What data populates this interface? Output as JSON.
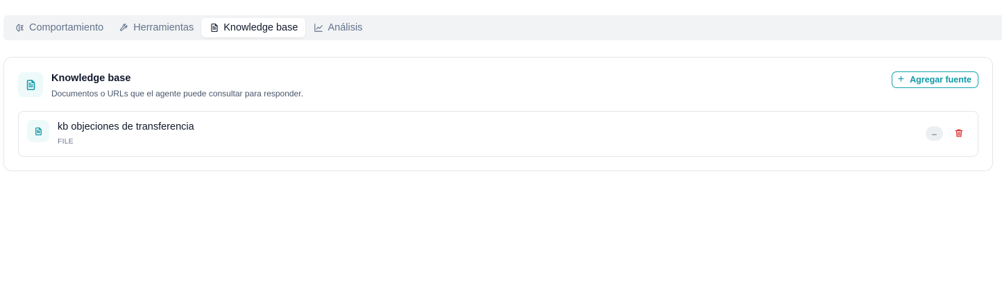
{
  "tabs": [
    {
      "label": "Comportamiento",
      "icon": "brain-icon",
      "active": false
    },
    {
      "label": "Herramientas",
      "icon": "wrench-icon",
      "active": false
    },
    {
      "label": "Knowledge base",
      "icon": "document-icon",
      "active": true
    },
    {
      "label": "Análisis",
      "icon": "line-chart-icon",
      "active": false
    }
  ],
  "knowledge_base": {
    "title": "Knowledge base",
    "subtitle": "Documentos o URLs que el agente puede consultar para responder.",
    "add_label": "Agregar fuente",
    "sources": [
      {
        "name": "kb objeciones de transferencia",
        "type": "FILE",
        "toggle_symbol": "–"
      }
    ]
  },
  "colors": {
    "accent": "#0e9aa7",
    "danger": "#dc2626",
    "icon_bg": "#eef9fa"
  }
}
